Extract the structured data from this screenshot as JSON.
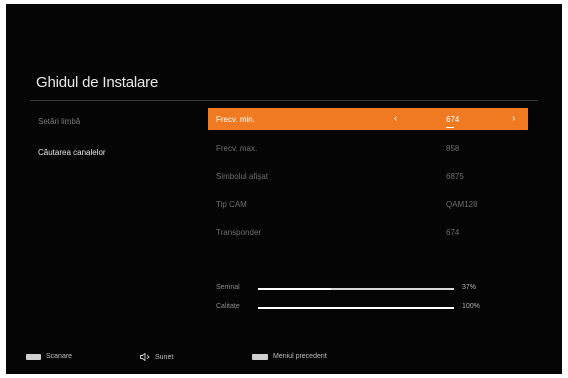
{
  "app": {
    "title": "Ghidul de Instalare"
  },
  "sidebar": {
    "items": [
      {
        "label": "Setări limbă"
      },
      {
        "label": "Căutarea canalelor"
      }
    ]
  },
  "settings": {
    "rows": [
      {
        "label": "Frecv. min.",
        "value": "674"
      },
      {
        "label": "Frecv. max.",
        "value": "858"
      },
      {
        "label": "Simbolul afișat",
        "value": "6875"
      },
      {
        "label": "Tip CAM",
        "value": "QAM128"
      },
      {
        "label": "Transponder",
        "value": "674"
      }
    ],
    "selected_row": 0
  },
  "signal": {
    "strength": {
      "label": "Semnal",
      "value": "37%",
      "level": 0.37
    },
    "quality": {
      "label": "Calitate",
      "value": "100%",
      "level": 1.0
    }
  },
  "footer": {
    "scan": {
      "label": "Scanare"
    },
    "sound": {
      "label": "Sunet"
    },
    "back": {
      "label": "Meniul precedent"
    }
  },
  "colors": {
    "accent": "#f07a22",
    "background": "#050505"
  }
}
